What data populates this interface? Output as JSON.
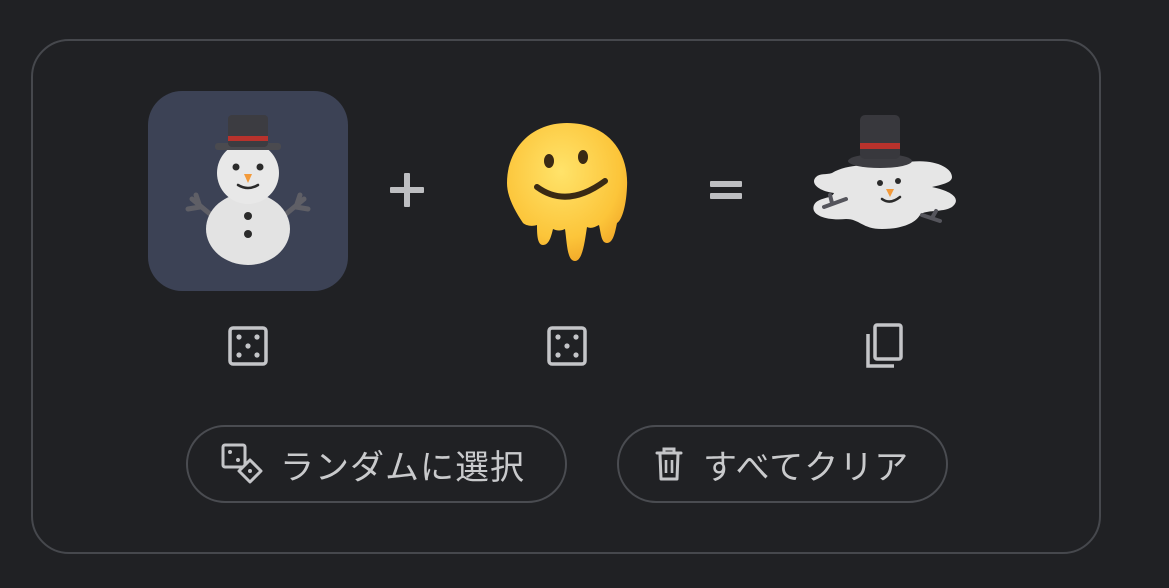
{
  "mixer": {
    "left_emoji": "snowman-emoji",
    "right_emoji": "melting-face-emoji",
    "result_emoji": "melting-snowman-mashup",
    "plus_symbol": "+",
    "equals_symbol": "="
  },
  "actions": {
    "randomize_label": "ランダムに選択",
    "clear_label": "すべてクリア"
  },
  "icons": {
    "left_randomize": "dice-icon",
    "right_randomize": "dice-icon",
    "copy": "copy-icon",
    "randomize": "dice-pair-icon",
    "clear": "trash-icon"
  },
  "colors": {
    "background": "#202124",
    "panel_border": "#46484d",
    "selected_slot": "#3c4255",
    "text": "#c9cacc"
  }
}
